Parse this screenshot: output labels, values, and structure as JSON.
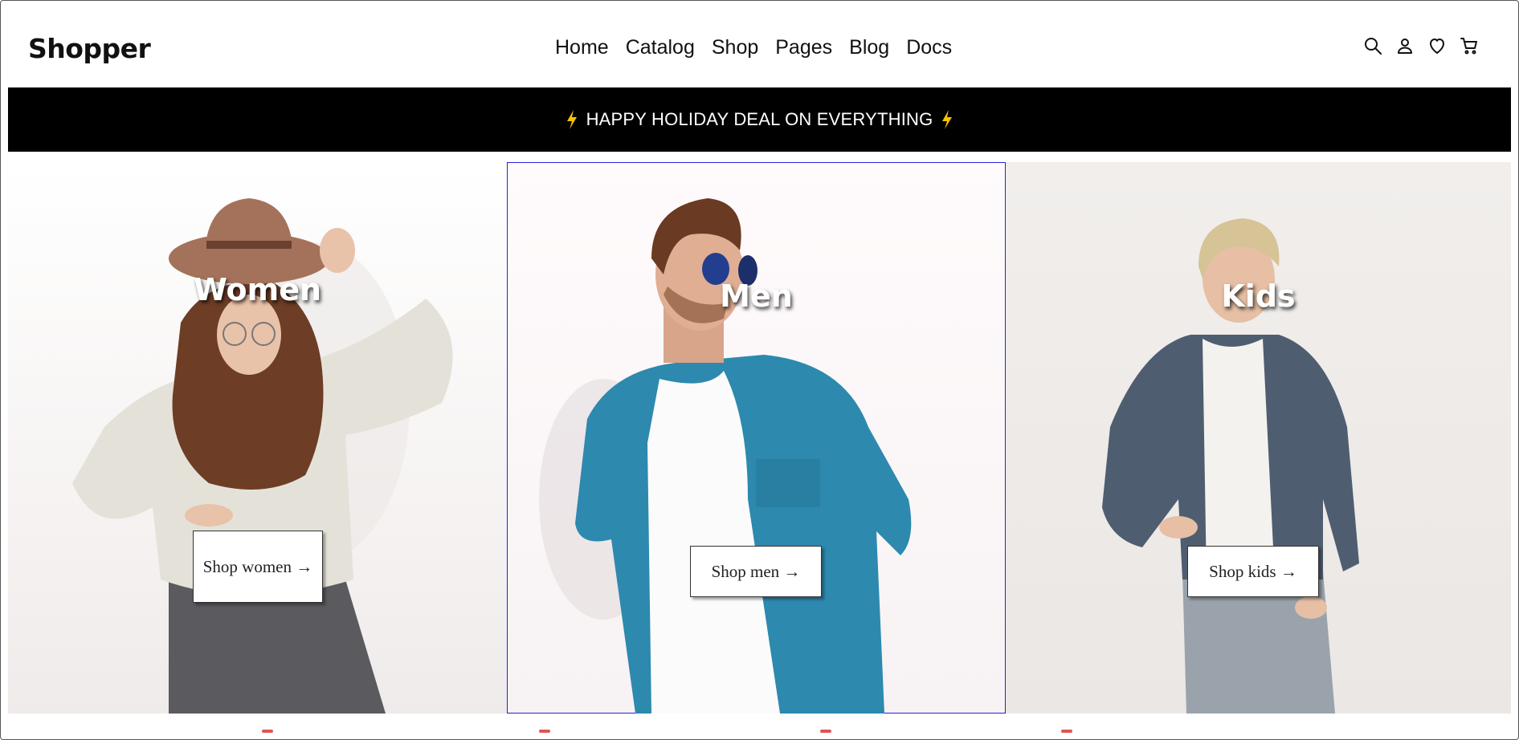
{
  "brand": {
    "name": "Shopper"
  },
  "nav": {
    "items": [
      "Home",
      "Catalog",
      "Shop",
      "Pages",
      "Blog",
      "Docs"
    ]
  },
  "header_icons": [
    "search-icon",
    "user-icon",
    "heart-icon",
    "cart-icon"
  ],
  "promo": {
    "text": "HAPPY HOLIDAY DEAL ON EVERYTHING",
    "icon": "lightning-icon",
    "icon_color": "#f5c400"
  },
  "categories": [
    {
      "title": "Women",
      "button": "Shop women →"
    },
    {
      "title": "Men",
      "button": "Shop men →"
    },
    {
      "title": "Kids",
      "button": "Shop kids →"
    }
  ],
  "colors": {
    "promo_bg": "#000000",
    "promo_text": "#ffffff",
    "selected_outline": "#2222dd"
  }
}
